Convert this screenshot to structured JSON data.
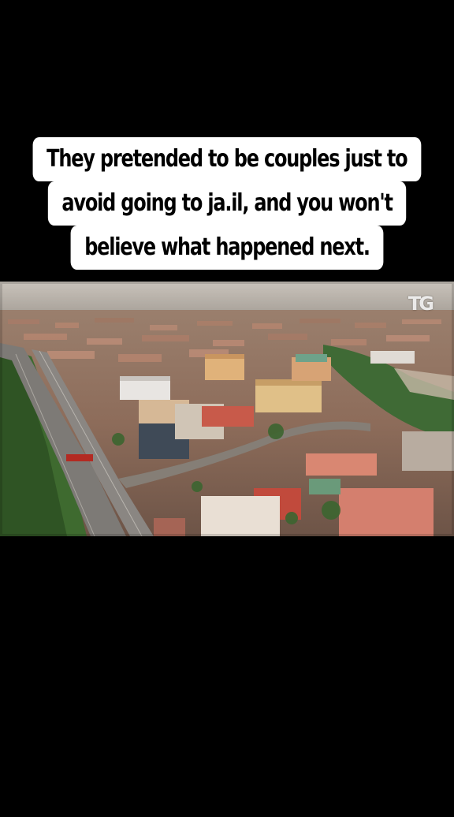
{
  "caption": {
    "lines": [
      "They pretended to be couples just to",
      "avoid going to ja.il, and you won't",
      "believe what happened next."
    ]
  },
  "video": {
    "watermark": "TG",
    "scene": "aerial-city-view"
  },
  "colors": {
    "background": "#000000",
    "caption_bg": "#ffffff",
    "caption_text": "#000000"
  }
}
